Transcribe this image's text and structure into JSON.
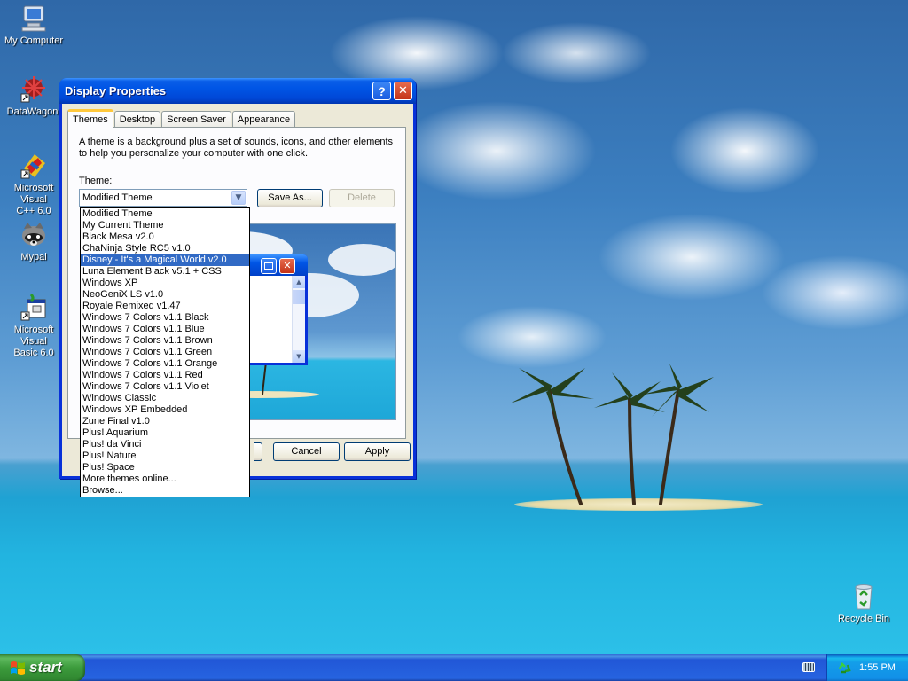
{
  "desktop": {
    "icons": [
      {
        "label": "My Computer"
      },
      {
        "label": "DataWagon."
      },
      {
        "label": "Microsoft Visual\nC++ 6.0"
      },
      {
        "label": "Mypal"
      },
      {
        "label": "Microsoft Visual\nBasic 6.0"
      },
      {
        "label": "Recycle Bin"
      }
    ]
  },
  "window": {
    "title": "Display Properties",
    "tabs": [
      "Themes",
      "Desktop",
      "Screen Saver",
      "Appearance"
    ],
    "description": "A theme is a background plus a set of sounds, icons, and other elements to help you personalize your computer with one click.",
    "theme_label": "Theme:",
    "theme_value": "Modified Theme",
    "save_as": "Save As...",
    "delete": "Delete",
    "ok": "OK",
    "cancel": "Cancel",
    "apply": "Apply"
  },
  "dropdown": {
    "selected_index": 4,
    "items": [
      "Modified Theme",
      "My Current Theme",
      "Black Mesa v2.0",
      "ChaNinja Style RC5 v1.0",
      "Disney - It's a Magical World v2.0",
      "Luna Element Black v5.1 + CSS",
      "Windows XP",
      "NeoGeniX LS v1.0",
      "Royale Remixed v1.47",
      "Windows 7 Colors v1.1 Black",
      "Windows 7 Colors v1.1 Blue",
      "Windows 7 Colors v1.1 Brown",
      "Windows 7 Colors v1.1 Green",
      "Windows 7 Colors v1.1 Orange",
      "Windows 7 Colors v1.1 Red",
      "Windows 7 Colors v1.1 Violet",
      "Windows Classic",
      "Windows XP Embedded",
      "Zune Final v1.0",
      "Plus! Aquarium",
      "Plus! da Vinci",
      "Plus! Nature",
      "Plus! Space",
      "More themes online...",
      "Browse..."
    ]
  },
  "taskbar": {
    "start_label": "start",
    "clock": "1:55 PM"
  },
  "colors": {
    "titlebar": "#0055e5",
    "selection": "#316ac5",
    "start_green": "#3c9b3c"
  }
}
